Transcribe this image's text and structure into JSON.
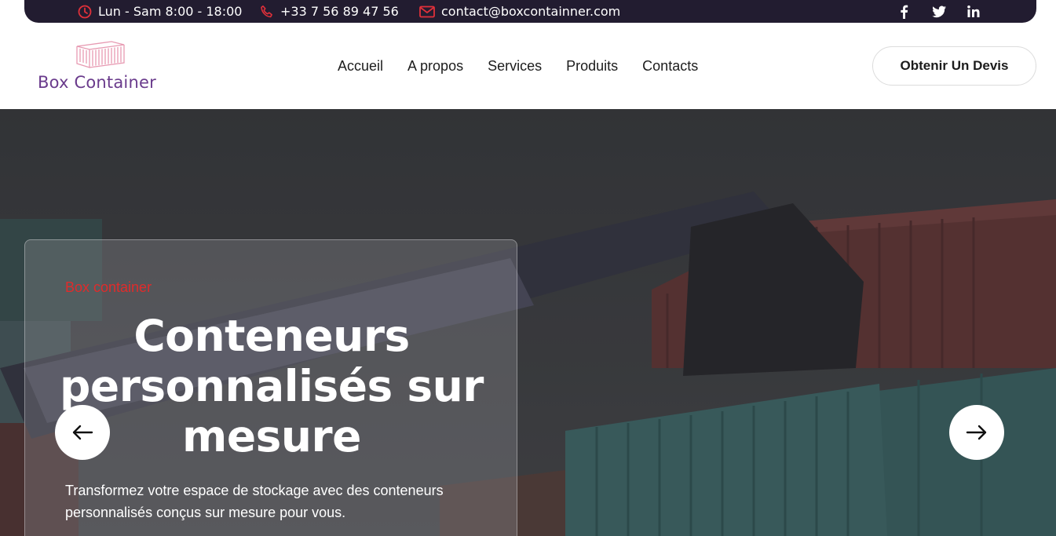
{
  "topbar": {
    "hours": "Lun - Sam 8:00 - 18:00",
    "phone": "+33 7 56 89 47 56",
    "email": "contact@boxcontainner.com",
    "socials": [
      "facebook-icon",
      "twitter-icon",
      "linkedin-icon"
    ]
  },
  "header": {
    "brand": "Box Container",
    "nav": [
      "Accueil",
      "A propos",
      "Services",
      "Produits",
      "Contacts"
    ],
    "cta": "Obtenir Un Devis"
  },
  "hero": {
    "eyebrow": "Box container",
    "title": "Conteneurs personnalisés sur mesure",
    "text": "Transformez votre espace de stockage avec des conteneurs personnalisés conçus sur mesure pour vous."
  },
  "colors": {
    "topbar_bg": "#221c30",
    "accent_red": "#e02b2b",
    "brand_purple": "#6a3b8c"
  }
}
